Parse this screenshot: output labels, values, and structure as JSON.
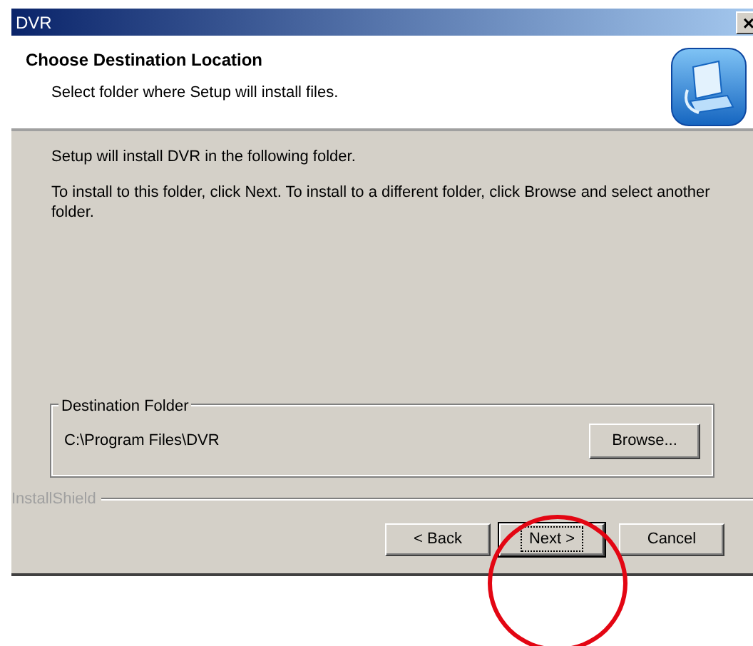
{
  "window": {
    "title": "DVR",
    "close_glyph": "×"
  },
  "header": {
    "title": "Choose Destination Location",
    "subtitle": "Select folder where Setup will install files."
  },
  "body": {
    "paragraphs": [
      "Setup will install DVR in the following folder.",
      "To install to this folder, click Next. To install to a different folder, click Browse and select another folder."
    ]
  },
  "destination": {
    "legend": "Destination Folder",
    "path": "C:\\Program Files\\DVR",
    "browse_button": "Browse..."
  },
  "brand": "InstallShield",
  "buttons": [
    {
      "label": "< Back",
      "default": false
    },
    {
      "label": "Next >",
      "default": true
    },
    {
      "label": "Cancel",
      "default": false
    }
  ],
  "annotation": {
    "kind": "circle",
    "color": "#e30613"
  }
}
